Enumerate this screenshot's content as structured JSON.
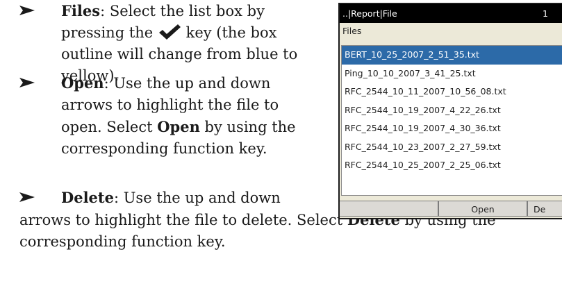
{
  "instructions": {
    "files": {
      "term": "Files",
      "text_before_icon": ": Select the list box by pressing the",
      "text_after_icon": "key (the box outline will change from blue to yellow)."
    },
    "open": {
      "term": "Open",
      "text_1": ": Use the up and down arrows to highlight the file to open. Select",
      "term_2": "Open",
      "text_2": "by using the corresponding function key."
    },
    "delete": {
      "term": "Delete",
      "line_1": ": Use the up and down",
      "line_2a": "arrows to highlight the file to delete. Select",
      "term_2": "Delete",
      "line_2b": "by using the",
      "line_3": "corresponding function key."
    }
  },
  "device_screen": {
    "title": "..|Report|File",
    "page_number": "1",
    "list_label": "Files",
    "files": [
      "BERT_10_25_2007_2_51_35.txt",
      "Ping_10_10_2007_3_41_25.txt",
      "RFC_2544_10_11_2007_10_56_08.txt",
      "RFC_2544_10_19_2007_4_22_26.txt",
      "RFC_2544_10_19_2007_4_30_36.txt",
      "RFC_2544_10_23_2007_2_27_59.txt",
      "RFC_2544_10_25_2007_2_25_06.txt"
    ],
    "selected_index": 0,
    "softkeys": [
      "",
      "Open",
      "De"
    ]
  }
}
